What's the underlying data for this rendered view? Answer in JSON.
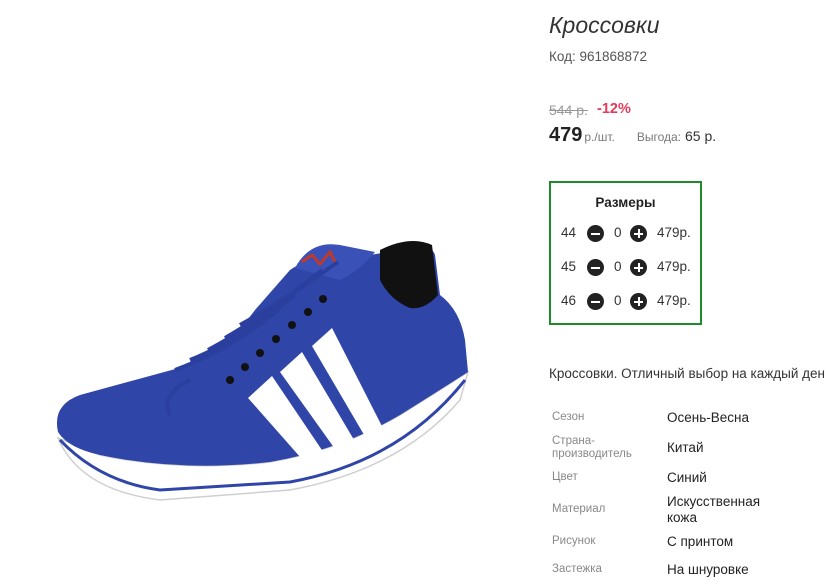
{
  "product": {
    "title": "Кроссовки",
    "code": "Код: 961868872",
    "old_price": "544 р.",
    "discount": "-12%",
    "price": "479",
    "unit": "р./шт.",
    "savings_label": "Выгода:",
    "savings_value": "65 р.",
    "image_icon": "sneaker-product-photo",
    "colors": {
      "accent_green": "#1f8a2a",
      "discount_red": "#e33a5a",
      "shoe_blue": "#2f45a8"
    }
  },
  "sizes": {
    "title": "Размеры",
    "rows": [
      {
        "size": "44",
        "qty": "0",
        "price": "479р."
      },
      {
        "size": "45",
        "qty": "0",
        "price": "479р."
      },
      {
        "size": "46",
        "qty": "0",
        "price": "479р."
      }
    ]
  },
  "description": "Кроссовки. Отличный выбор на каждый ден",
  "specs": [
    {
      "label": "Сезон",
      "value": "Осень-Весна"
    },
    {
      "label": "Страна-\nпроизводитель",
      "value": "Китай"
    },
    {
      "label": "Цвет",
      "value": "Синий"
    },
    {
      "label": "Материал",
      "value": "Искусственная\nкожа"
    },
    {
      "label": "Рисунок",
      "value": "С принтом"
    },
    {
      "label": "Застежка",
      "value": "На шнуровке"
    }
  ]
}
